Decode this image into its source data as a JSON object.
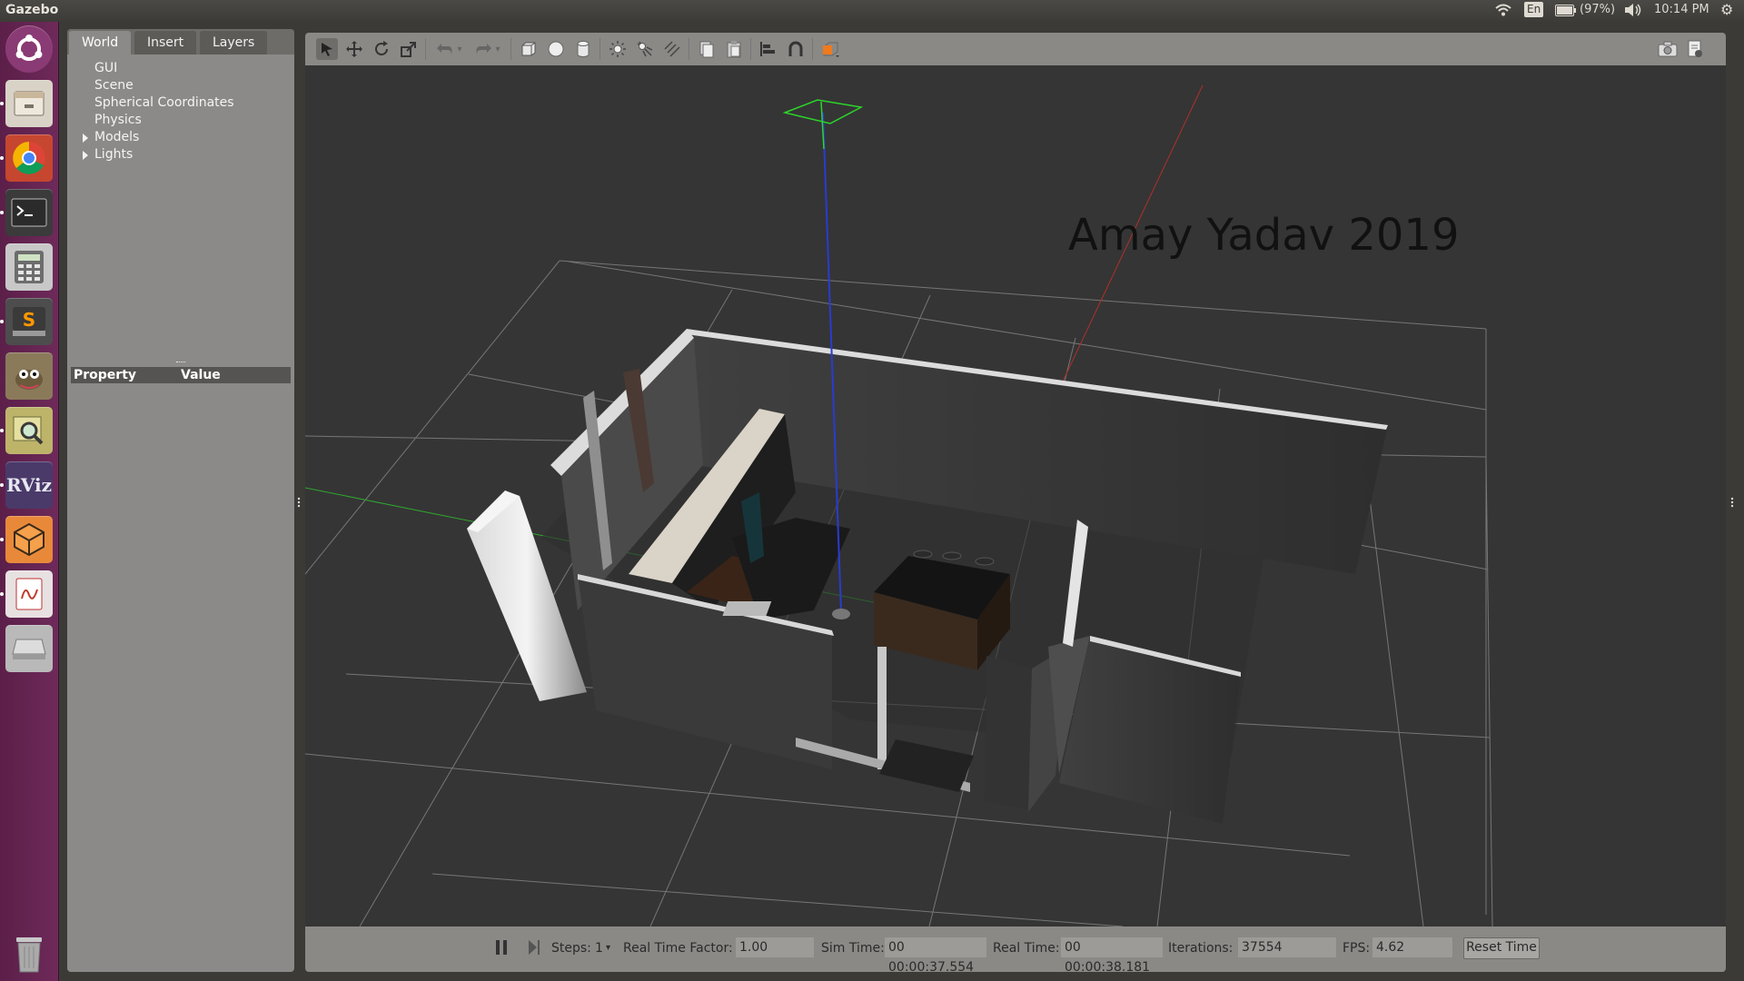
{
  "topbar": {
    "app_title": "Gazebo",
    "keyboard": "En",
    "battery": "(97%)",
    "time": "10:14 PM"
  },
  "launcher": {
    "items": [
      "ubuntu-dash-icon",
      "files-icon",
      "chrome-icon",
      "terminal-icon",
      "calculator-icon",
      "sublime-text-icon",
      "gimp-icon",
      "system-monitor-icon",
      "rviz-icon",
      "gazebo-icon",
      "document-viewer-icon",
      "drive-icon",
      "trash-icon"
    ],
    "rviz_label": "RViz"
  },
  "left_panel": {
    "tabs": [
      {
        "label": "World",
        "active": true
      },
      {
        "label": "Insert",
        "active": false
      },
      {
        "label": "Layers",
        "active": false
      }
    ],
    "tree": [
      {
        "label": "GUI",
        "expandable": false
      },
      {
        "label": "Scene",
        "expandable": false
      },
      {
        "label": "Spherical Coordinates",
        "expandable": false
      },
      {
        "label": "Physics",
        "expandable": false
      },
      {
        "label": "Models",
        "expandable": true
      },
      {
        "label": "Lights",
        "expandable": true
      }
    ],
    "property_header": {
      "property": "Property",
      "value": "Value"
    }
  },
  "toolbar": {
    "tools": [
      "select-arrow-icon",
      "translate-icon",
      "rotate-icon",
      "scale-icon",
      "undo-icon",
      "undo-history-icon",
      "redo-icon",
      "redo-history-icon",
      "box-shape-icon",
      "sphere-shape-icon",
      "cylinder-shape-icon",
      "point-light-icon",
      "spot-light-icon",
      "directional-light-icon",
      "copy-icon",
      "paste-icon",
      "align-icon",
      "snap-icon",
      "view-angle-icon",
      "screenshot-icon",
      "record-log-icon"
    ]
  },
  "scene": {
    "watermark": "Amay Yadav 2019",
    "grid_color": "#8c8c8c",
    "axis_x_color": "#b0302a",
    "axis_y_color": "#2fa82f",
    "axis_z_color": "#2a3bd0"
  },
  "status": {
    "steps_label": "Steps:",
    "steps_value": "1",
    "rtf_label": "Real Time Factor:",
    "rtf_value": "1.00",
    "sim_time_label": "Sim Time:",
    "sim_time_value": "00 00:00:37.554",
    "real_time_label": "Real Time:",
    "real_time_value": "00 00:00:38.181",
    "iterations_label": "Iterations:",
    "iterations_value": "37554",
    "fps_label": "FPS:",
    "fps_value": "4.62",
    "reset_label": "Reset Time"
  }
}
